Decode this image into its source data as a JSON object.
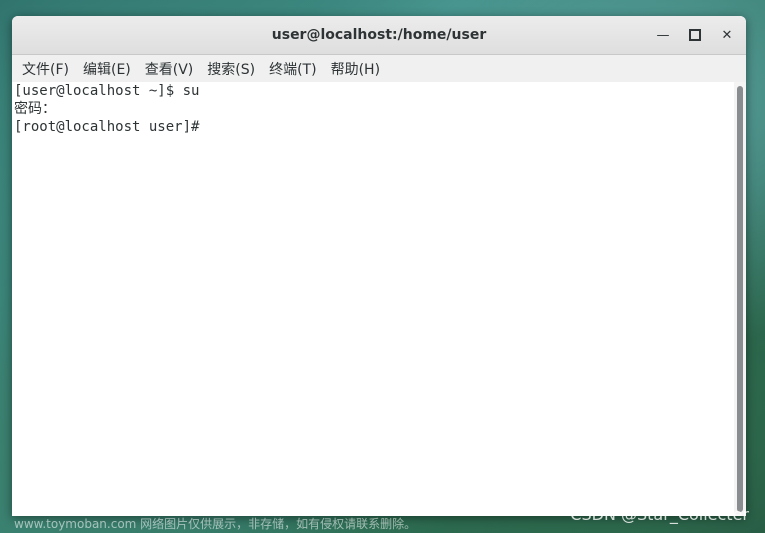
{
  "window": {
    "title": "user@localhost:/home/user",
    "minimize_icon": "minimize-icon",
    "maximize_icon": "maximize-icon",
    "close_icon": "close-icon"
  },
  "menu": [
    {
      "label": "文件(F)"
    },
    {
      "label": "编辑(E)"
    },
    {
      "label": "查看(V)"
    },
    {
      "label": "搜索(S)"
    },
    {
      "label": "终端(T)"
    },
    {
      "label": "帮助(H)"
    }
  ],
  "terminal": {
    "lines": [
      "[user@localhost ~]$ su",
      "密码：",
      "[root@localhost user]# "
    ]
  },
  "watermarks": {
    "left": "www.toymoban.com 网络图片仅供展示，非存储，如有侵权请联系删除。",
    "right": "CSDN @Star_Collecter"
  }
}
